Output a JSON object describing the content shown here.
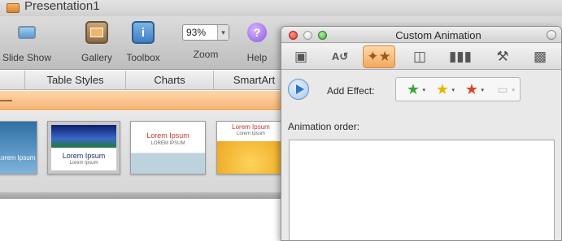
{
  "window": {
    "title": "Presentation1"
  },
  "toolbar": {
    "items": [
      {
        "label": "Slide Show",
        "icon": "slideshow-icon"
      },
      {
        "label": "Gallery",
        "icon": "gallery-icon"
      },
      {
        "label": "Toolbox",
        "icon": "toolbox-icon"
      },
      {
        "label": "Zoom",
        "value": "93%"
      },
      {
        "label": "Help",
        "icon": "help-icon"
      }
    ]
  },
  "ribbon": {
    "tabs": [
      "Table Styles",
      "Charts",
      "SmartArt"
    ]
  },
  "gallery": {
    "thumbnails": [
      {
        "title": "Lorem Ipsum",
        "subtitle": ""
      },
      {
        "title": "Lorem Ipsum",
        "subtitle": "Lorem Ipsum"
      },
      {
        "title": "Lorem Ipsum",
        "subtitle": "LOREM IPSUM"
      },
      {
        "title": "Lorem Ipsum",
        "subtitle": "Lorem Ipsum"
      }
    ]
  },
  "palette": {
    "title": "Custom Animation",
    "tabs": [
      "formatting-icon",
      "text-icon",
      "animation-icon",
      "media-icon",
      "library-icon",
      "tools-icon",
      "toolbox-case-icon"
    ],
    "active_tab_index": 2,
    "add_effect_label": "Add Effect:",
    "effects": [
      {
        "name": "entrance-effect",
        "color": "#3aa53a"
      },
      {
        "name": "emphasis-effect",
        "color": "#e6b800"
      },
      {
        "name": "exit-effect",
        "color": "#d9442a"
      },
      {
        "name": "motion-path-effect",
        "color": "#b8b8b8"
      }
    ],
    "animation_order_label": "Animation order:"
  },
  "colors": {
    "accent": "#f3a860",
    "ribbon_strip": "#f6b577"
  }
}
